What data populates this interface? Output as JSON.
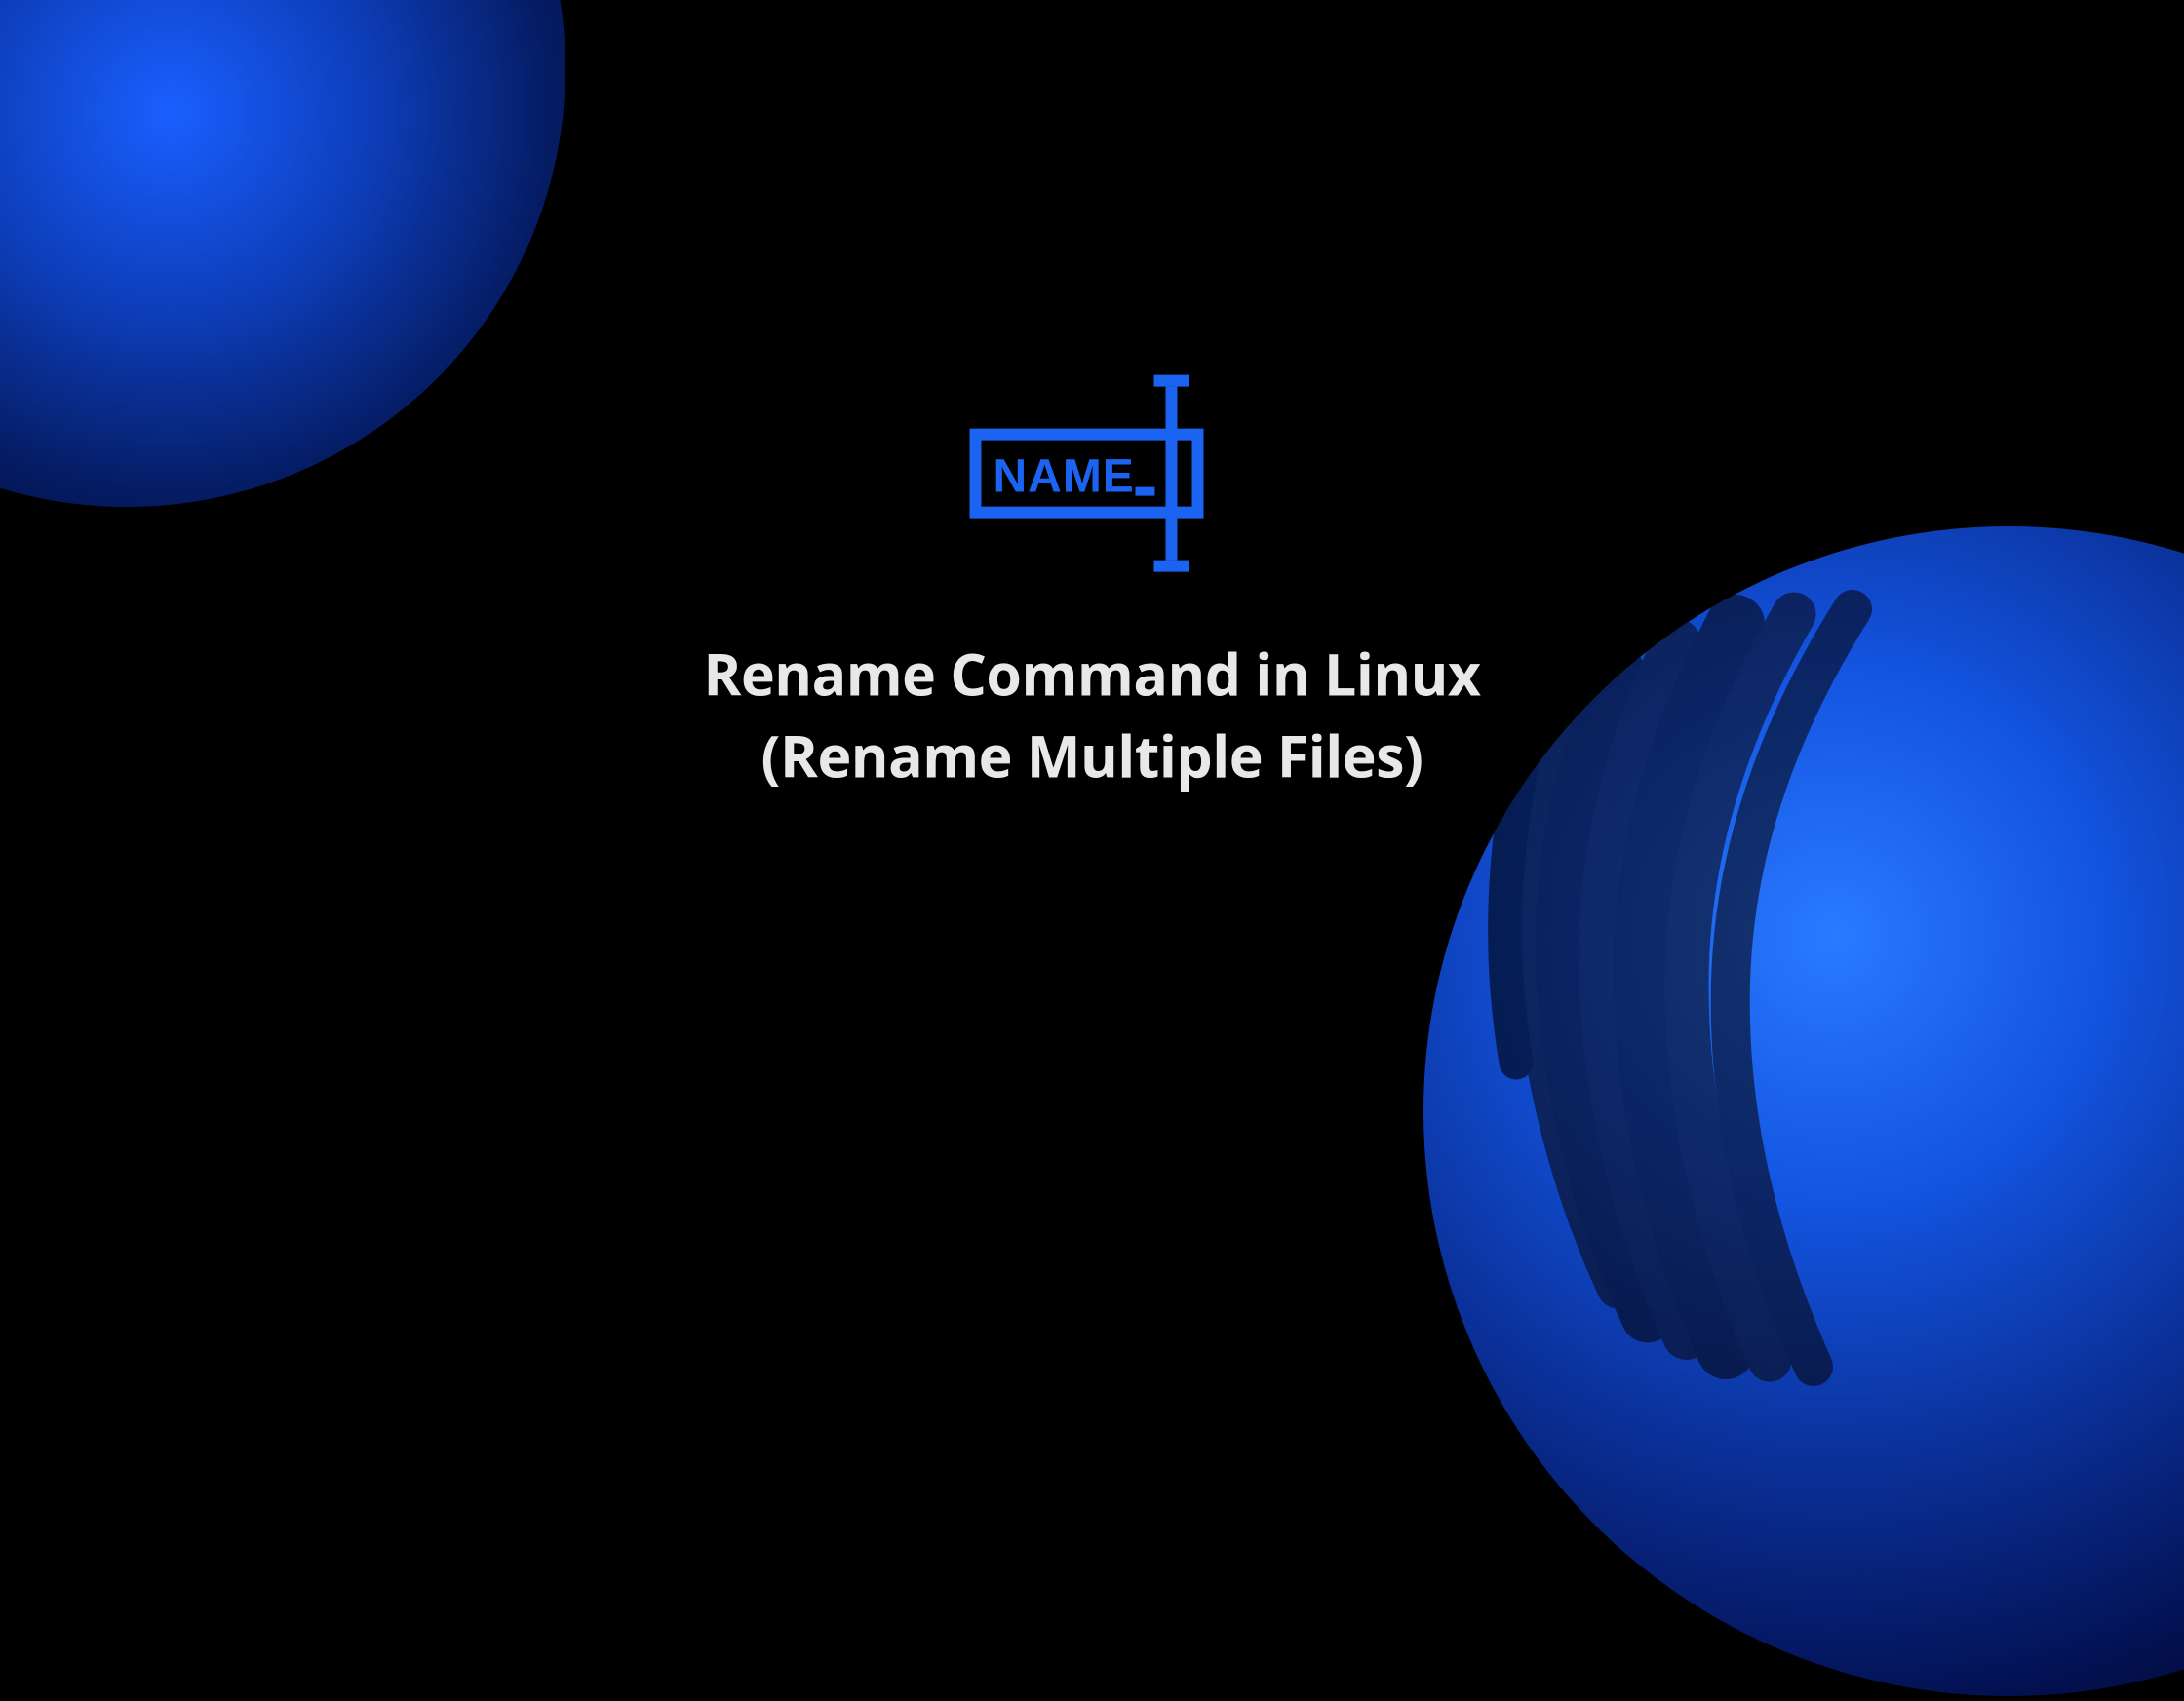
{
  "icon": {
    "name": "rename-icon",
    "label": "NAME_",
    "color": "#1b64f2"
  },
  "title": {
    "line1": "Rename Command in Linux",
    "line2": "(Rename Multiple Files)"
  },
  "colors": {
    "background": "#000000",
    "text": "#e8e8e8",
    "accent": "#1b64f2",
    "orbGradientStart": "#2a7aff",
    "orbGradientEnd": "#000000"
  }
}
